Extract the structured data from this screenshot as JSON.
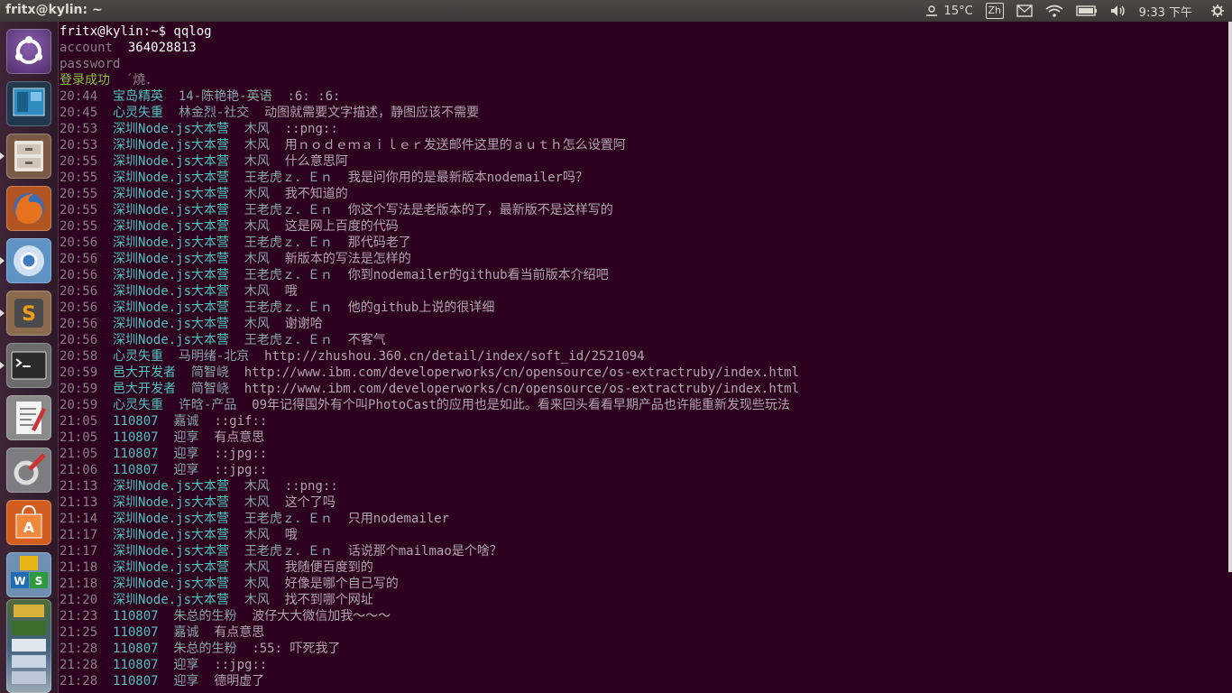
{
  "window_title": "fritx@kylin: ~",
  "panel": {
    "temperature": "15°C",
    "keyboard": "Zh",
    "clock": "9:33 下午",
    "colors": {
      "bg": "#3c3b37",
      "fg": "#dfdbd2"
    }
  },
  "launcher": {
    "items": [
      {
        "name": "dash",
        "icon": "ubuntu-logo-icon"
      },
      {
        "name": "files-frame",
        "icon": "workspace-switcher-icon"
      },
      {
        "name": "files",
        "icon": "file-cabinet-icon"
      },
      {
        "name": "firefox",
        "icon": "firefox-icon"
      },
      {
        "name": "chromium",
        "icon": "chromium-icon"
      },
      {
        "name": "sublime-text",
        "icon": "sublime-text-icon"
      },
      {
        "name": "terminal",
        "icon": "terminal-icon"
      },
      {
        "name": "text-editor",
        "icon": "text-editor-icon"
      },
      {
        "name": "system-settings",
        "icon": "settings-tools-icon"
      },
      {
        "name": "software-center",
        "icon": "shopping-bag-icon"
      },
      {
        "name": "wps-office",
        "icon": "wps-icon"
      },
      {
        "name": "stacked-apps",
        "icon": "stacked-apps-icon"
      }
    ]
  },
  "terminal": {
    "colors": {
      "bg": "#2c001e",
      "default": "#b1a4ad",
      "time": "#8b7e88",
      "bright": "#ffffff",
      "name": "#4ec4bc",
      "nick": "#8aa6a8",
      "green": "#8ec13d"
    },
    "prompt": "fritx@kylin:~$ qqlog",
    "account_label": "account",
    "account_value": "364028813",
    "password_label": "password",
    "login_status": "登录成功",
    "login_suffix": "´燒．",
    "messages": [
      {
        "time": "20:44",
        "group": "宝岛精英",
        "sender": "14-陈艳艳-英语",
        "text": ":6: :6:"
      },
      {
        "time": "20:45",
        "group": "心灵失重",
        "sender": "林金烈-社交",
        "text": "动图就需要文字描述，静图应该不需要"
      },
      {
        "time": "20:53",
        "group": "深圳Node.js大本营",
        "sender": "木风",
        "text": "::png::"
      },
      {
        "time": "20:53",
        "group": "深圳Node.js大本营",
        "sender": "木风",
        "text": "用ｎｏｄｅｍａｉｌｅｒ发送邮件这里的ａｕｔｈ怎么设置阿"
      },
      {
        "time": "20:55",
        "group": "深圳Node.js大本营",
        "sender": "木风",
        "text": "什么意思阿"
      },
      {
        "time": "20:55",
        "group": "深圳Node.js大本营",
        "sender": "王老虎ｚ．Ｅｎ",
        "text": "我是问你用的是最新版本nodemailer吗？"
      },
      {
        "time": "20:55",
        "group": "深圳Node.js大本营",
        "sender": "木风",
        "text": "我不知道的"
      },
      {
        "time": "20:55",
        "group": "深圳Node.js大本营",
        "sender": "王老虎ｚ．Ｅｎ",
        "text": "你这个写法是老版本的了，最新版不是这样写的"
      },
      {
        "time": "20:55",
        "group": "深圳Node.js大本营",
        "sender": "木风",
        "text": "这是网上百度的代码"
      },
      {
        "time": "20:56",
        "group": "深圳Node.js大本营",
        "sender": "王老虎ｚ．Ｅｎ",
        "text": "那代码老了"
      },
      {
        "time": "20:56",
        "group": "深圳Node.js大本营",
        "sender": "木风",
        "text": "新版本的写法是怎样的"
      },
      {
        "time": "20:56",
        "group": "深圳Node.js大本营",
        "sender": "王老虎ｚ．Ｅｎ",
        "text": "你到nodemailer的github看当前版本介绍吧"
      },
      {
        "time": "20:56",
        "group": "深圳Node.js大本营",
        "sender": "木风",
        "text": "哦"
      },
      {
        "time": "20:56",
        "group": "深圳Node.js大本营",
        "sender": "王老虎ｚ．Ｅｎ",
        "text": "他的github上说的很详细"
      },
      {
        "time": "20:56",
        "group": "深圳Node.js大本营",
        "sender": "木风",
        "text": "谢谢哈"
      },
      {
        "time": "20:56",
        "group": "深圳Node.js大本营",
        "sender": "王老虎ｚ．Ｅｎ",
        "text": "不客气"
      },
      {
        "time": "20:58",
        "group": "心灵失重",
        "sender": "马明绪-北京",
        "text": "http://zhushou.360.cn/detail/index/soft_id/2521094"
      },
      {
        "time": "20:59",
        "group": "邑大开发者",
        "sender": "简智峣",
        "text": "http://www.ibm.com/developerworks/cn/opensource/os-extractruby/index.html"
      },
      {
        "time": "20:59",
        "group": "邑大开发者",
        "sender": "简智峣",
        "text": "http://www.ibm.com/developerworks/cn/opensource/os-extractruby/index.html"
      },
      {
        "time": "20:59",
        "group": "心灵失重",
        "sender": "许晗-产品",
        "text": "09年记得国外有个叫PhotoCast的应用也是如此。看来回头看看早期产品也许能重新发现些玩法"
      },
      {
        "time": "21:05",
        "group": "110807",
        "sender": "嘉诚",
        "text": "::gif::"
      },
      {
        "time": "21:05",
        "group": "110807",
        "sender": "迎享",
        "text": "有点意思"
      },
      {
        "time": "21:05",
        "group": "110807",
        "sender": "迎享",
        "text": "::jpg::"
      },
      {
        "time": "21:06",
        "group": "110807",
        "sender": "迎享",
        "text": "::jpg::"
      },
      {
        "time": "21:13",
        "group": "深圳Node.js大本营",
        "sender": "木风",
        "text": "::png::"
      },
      {
        "time": "21:13",
        "group": "深圳Node.js大本营",
        "sender": "木风",
        "text": "这个了吗"
      },
      {
        "time": "21:14",
        "group": "深圳Node.js大本营",
        "sender": "王老虎ｚ．Ｅｎ",
        "text": "只用nodemailer"
      },
      {
        "time": "21:17",
        "group": "深圳Node.js大本营",
        "sender": "木风",
        "text": "哦"
      },
      {
        "time": "21:17",
        "group": "深圳Node.js大本营",
        "sender": "王老虎ｚ．Ｅｎ",
        "text": "话说那个mailmao是个啥？"
      },
      {
        "time": "21:18",
        "group": "深圳Node.js大本营",
        "sender": "木风",
        "text": "我随便百度到的"
      },
      {
        "time": "21:18",
        "group": "深圳Node.js大本营",
        "sender": "木风",
        "text": "好像是哪个自己写的"
      },
      {
        "time": "21:20",
        "group": "深圳Node.js大本营",
        "sender": "木风",
        "text": "找不到哪个网址"
      },
      {
        "time": "21:23",
        "group": "110807",
        "sender": "朱总的生粉",
        "text": "波仔大大微信加我～～～"
      },
      {
        "time": "21:25",
        "group": "110807",
        "sender": "嘉诚",
        "text": "有点意思"
      },
      {
        "time": "21:28",
        "group": "110807",
        "sender": "朱总的生粉",
        "text": ":55: 吓死我了"
      },
      {
        "time": "21:28",
        "group": "110807",
        "sender": "迎享",
        "text": "::jpg::"
      },
      {
        "time": "21:28",
        "group": "110807",
        "sender": "迎享",
        "text": "德明虚了"
      }
    ]
  }
}
